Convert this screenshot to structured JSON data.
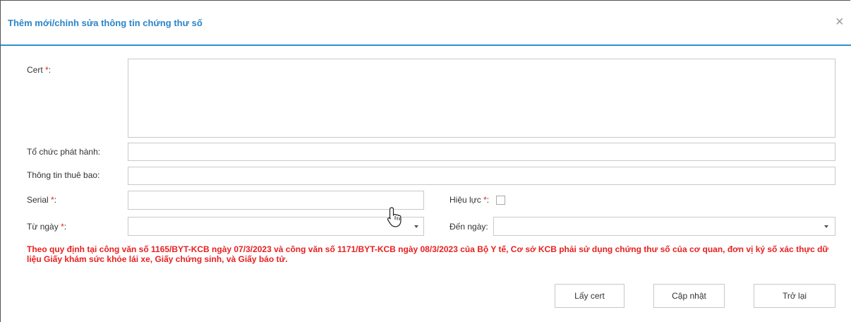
{
  "dialog": {
    "title": "Thêm mới/chỉnh sửa thông tin chứng thư số",
    "close_symbol": "×"
  },
  "form": {
    "cert_label": "Cert",
    "cert_suffix": ":",
    "issuer_label": "Tổ chức phát hành:",
    "subscriber_label": "Thông tin thuê bao:",
    "serial_label": "Serial",
    "serial_suffix": ":",
    "validity_label": "Hiệu lực",
    "validity_suffix": ":",
    "from_date_label": "Từ ngày",
    "from_date_suffix": ":",
    "to_date_label": "Đến ngày:",
    "required_mark": "*",
    "cert_value": "",
    "issuer_value": "",
    "subscriber_value": "",
    "serial_value": "",
    "from_date_value": "",
    "to_date_value": "",
    "validity_checked": false
  },
  "notice": {
    "text": "Theo quy định tại công văn số 1165/BYT-KCB ngày 07/3/2023 và công văn số 1171/BYT-KCB ngày 08/3/2023 của Bộ Y tế, Cơ sở KCB phải sử dụng chứng thư số của cơ quan, đơn vị ký số xác thực dữ liệu Giấy khám sức khỏe lái xe, Giấy chứng sinh, và Giấy báo tử."
  },
  "buttons": {
    "get_cert": "Lấy cert",
    "update": "Cập nhật",
    "back": "Trở lại"
  },
  "colors": {
    "title": "#2b85c8",
    "header_border": "#2f8fd0",
    "required": "#e02020",
    "notice": "#e82020"
  },
  "icons": {
    "close": "close-icon",
    "dropdown": "chevron-down-icon",
    "cursor": "hand-pointer-cursor-icon"
  }
}
